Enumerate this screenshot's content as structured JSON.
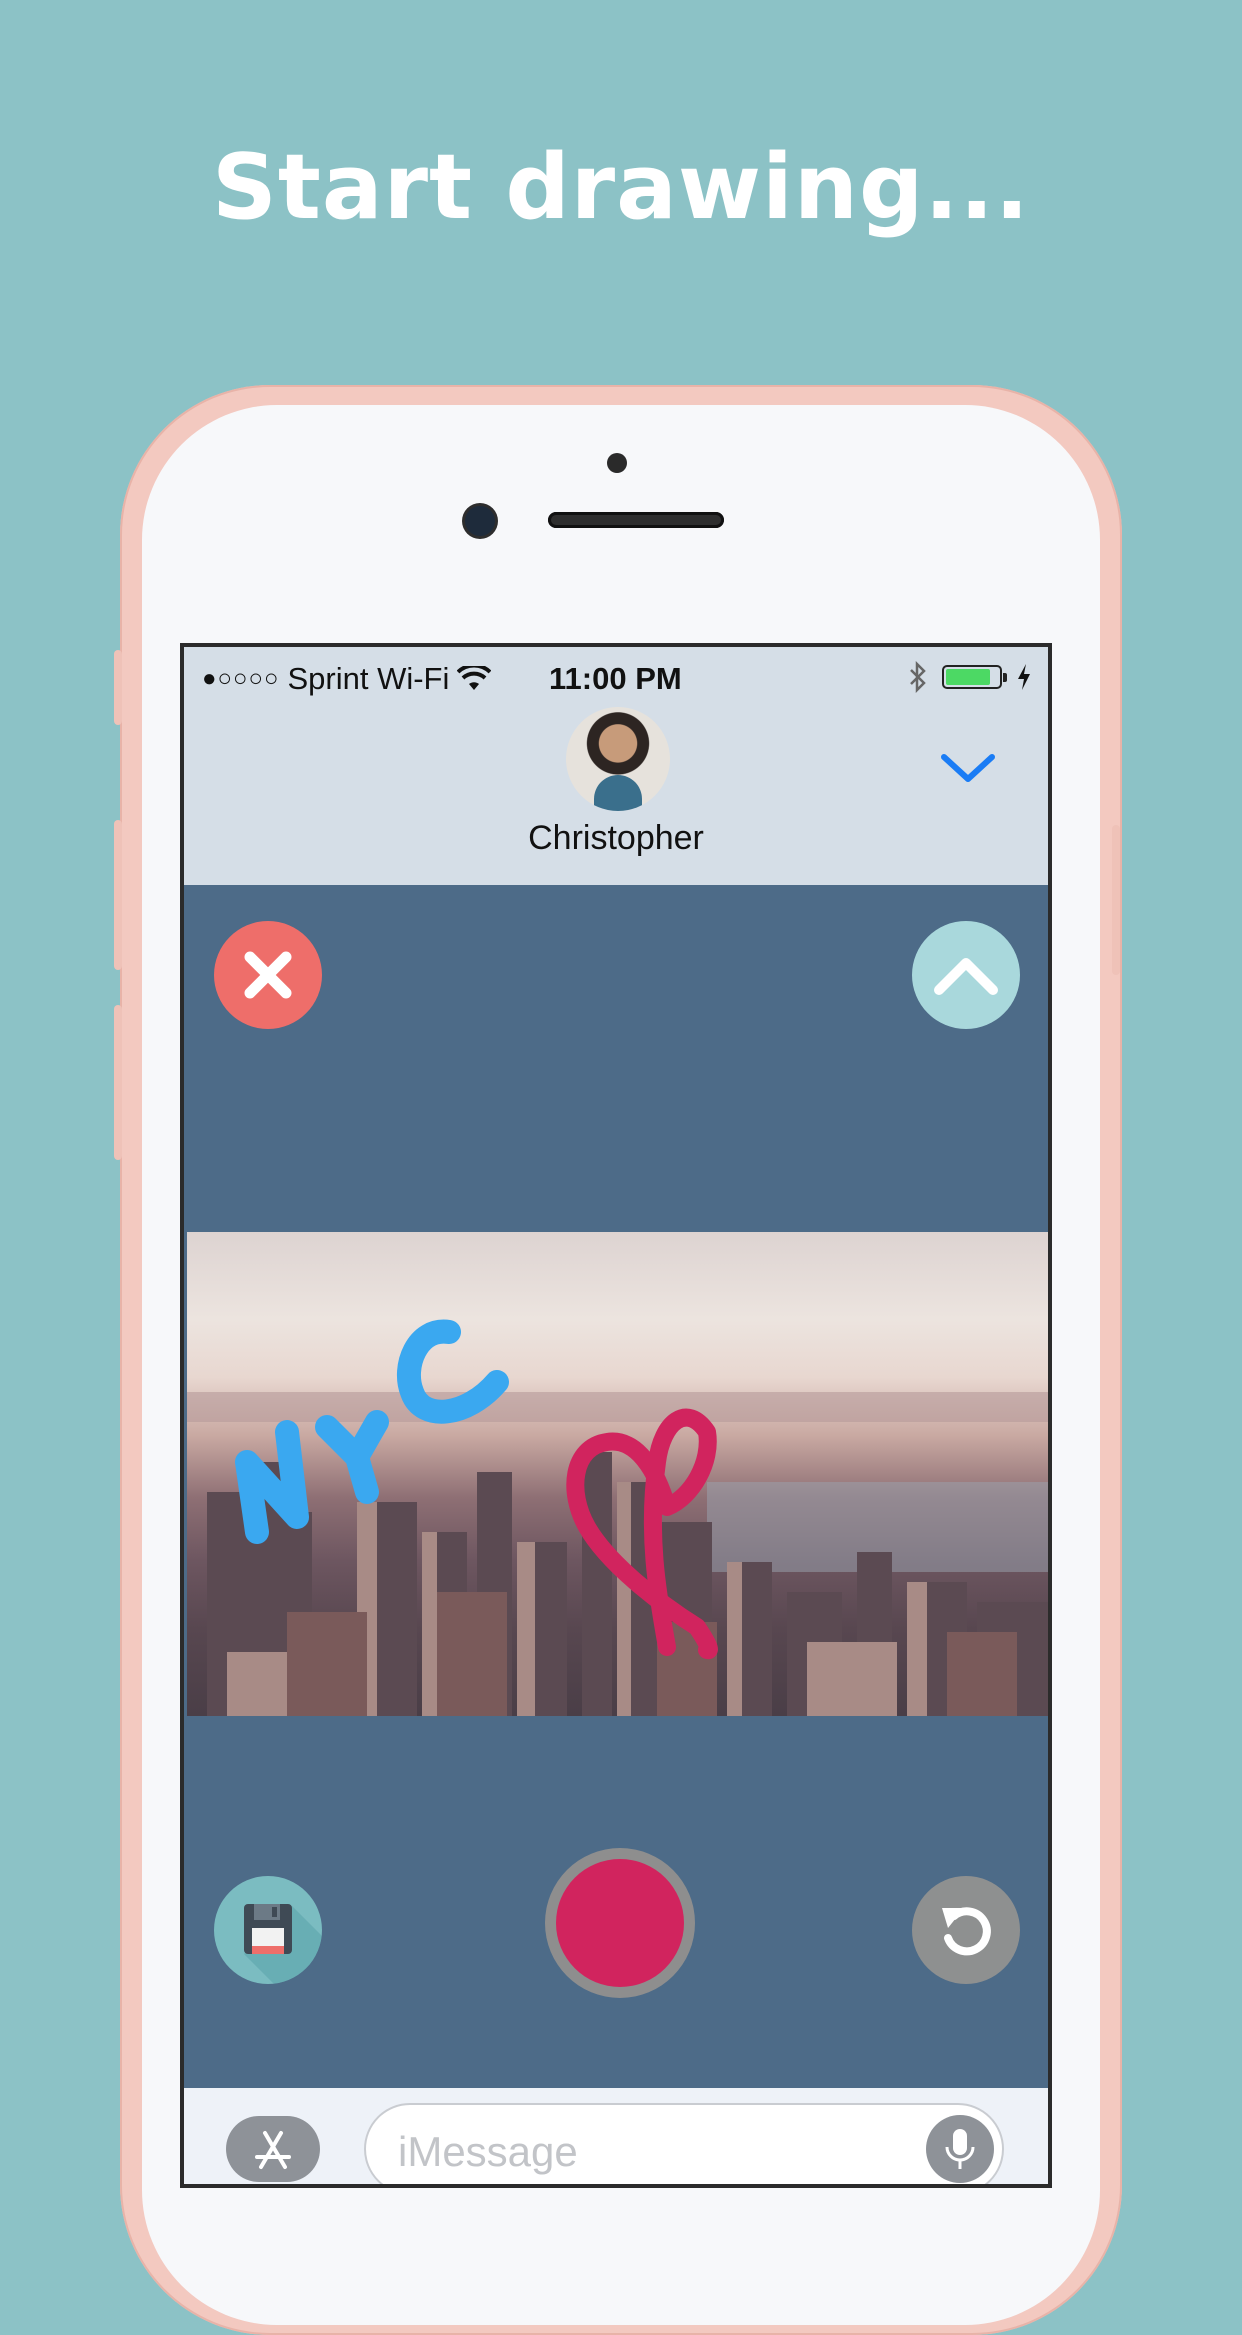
{
  "headline": "Start drawing...",
  "status_bar": {
    "carrier": "Sprint Wi-Fi",
    "time": "11:00 PM",
    "signal_dots": "●○○○○",
    "battery_level": 0.85
  },
  "contact": {
    "name": "Christopher"
  },
  "message_input": {
    "placeholder": "iMessage"
  },
  "icons": {
    "close": "close-icon",
    "expand": "chevron-up-icon",
    "dismiss": "chevron-down-icon",
    "save": "floppy-disk-icon",
    "record": "record-icon",
    "undo": "undo-icon",
    "app_store": "app-store-icon",
    "microphone": "microphone-icon"
  },
  "colors": {
    "background": "#8cc2c6",
    "canvas_panel": "#4d6b88",
    "close_button": "#ee6e6a",
    "expand_button": "#a9d8dc",
    "record_button": "#d1245e",
    "dismiss_chevron": "#1a7cf5",
    "drawing_blue": "#3aa8f0",
    "drawing_pink": "#d1245e"
  }
}
